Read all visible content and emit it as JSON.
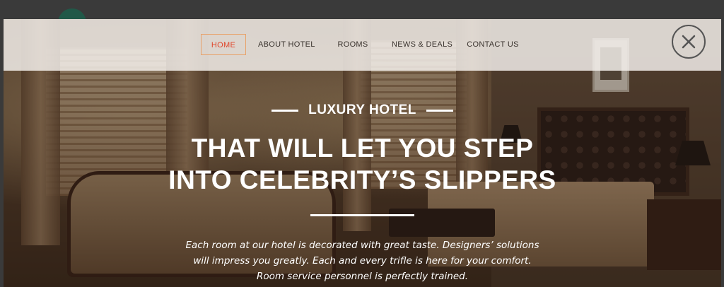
{
  "nav": {
    "items": [
      {
        "label": "HOME",
        "active": true
      },
      {
        "label": "ABOUT HOTEL",
        "active": false
      },
      {
        "label": "ROOMS",
        "active": false
      },
      {
        "label": "NEWS & DEALS",
        "active": false
      },
      {
        "label": "CONTACT US",
        "active": false
      }
    ],
    "close_icon": "close-icon",
    "active_color": "#e0462a"
  },
  "hero": {
    "kicker": "LUXURY HOTEL",
    "headline_line1": "THAT WILL LET YOU STEP",
    "headline_line2": "INTO CELEBRITY’S SLIPPERS",
    "description_line1": "Each room at our hotel is decorated with great taste. Designers’ solutions",
    "description_line2": "will impress you greatly. Each and every trifle is here for your comfort.",
    "description_line3": "Room service personnel is perfectly trained."
  }
}
